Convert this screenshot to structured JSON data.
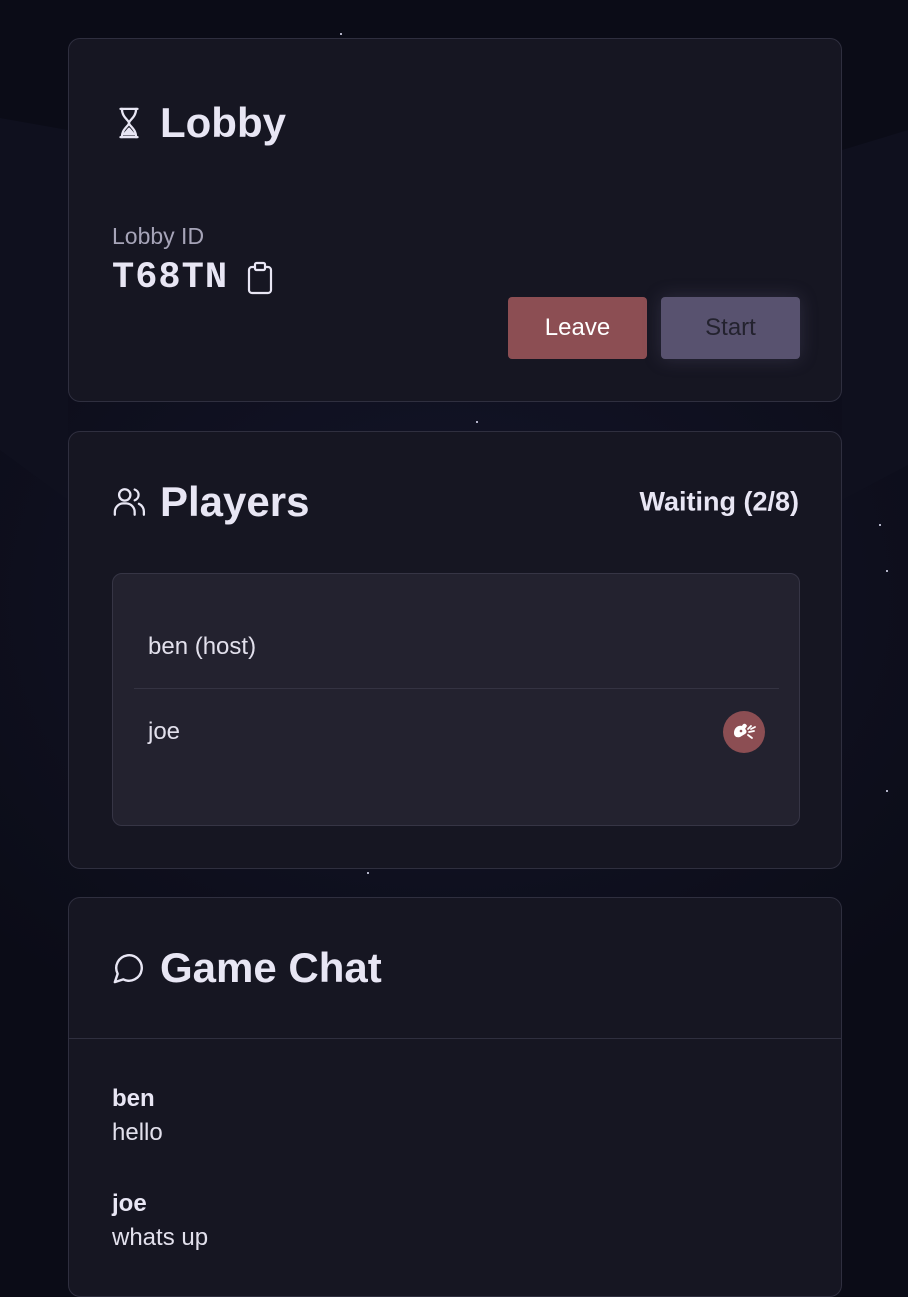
{
  "lobby": {
    "title": "Lobby",
    "id_label": "Lobby ID",
    "id_value": "T68TN",
    "leave_label": "Leave",
    "start_label": "Start"
  },
  "players": {
    "title": "Players",
    "status": "Waiting (2/8)",
    "list": [
      {
        "name": "ben (host)"
      },
      {
        "name": "joe"
      }
    ]
  },
  "chat": {
    "title": "Game Chat",
    "messages": [
      {
        "author": "ben",
        "text": "hello"
      },
      {
        "author": "joe",
        "text": "whats up"
      }
    ]
  },
  "colors": {
    "background": "#0b0c17",
    "card": "#161622",
    "leave_button": "#8c4e53",
    "start_button": "#58526f",
    "kick_button": "#8c4e53"
  },
  "icons": {
    "lobby": "hourglass-icon",
    "copy": "clipboard-icon",
    "players": "users-icon",
    "kick": "kick-icon",
    "chat": "chat-bubble-icon"
  }
}
